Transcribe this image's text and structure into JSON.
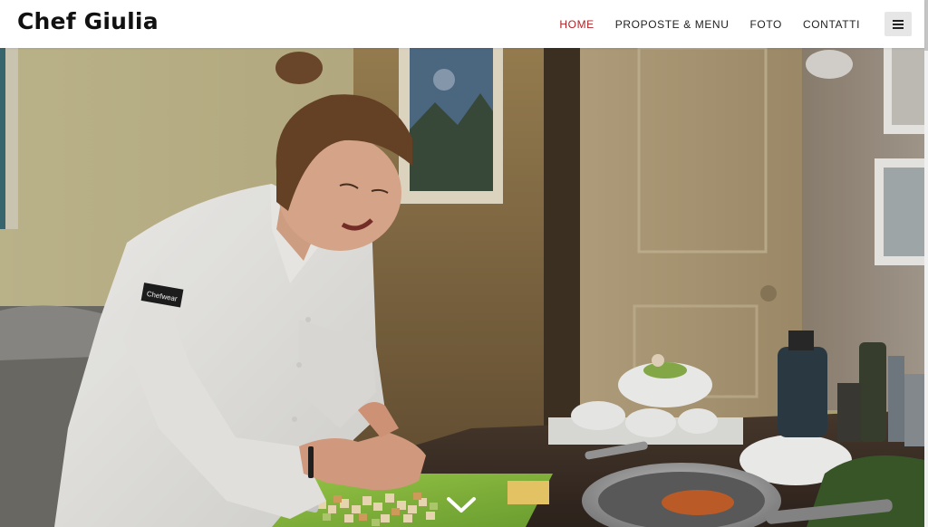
{
  "brand": {
    "name": "Chef Giulia"
  },
  "nav": {
    "items": [
      {
        "label": "HOME",
        "active": true
      },
      {
        "label": "PROPOSTE & MENU",
        "active": false
      },
      {
        "label": "FOTO",
        "active": false
      },
      {
        "label": "CONTATTI",
        "active": false
      }
    ],
    "menu_icon": "hamburger-icon"
  },
  "hero": {
    "patch_text": "Chefwear",
    "scroll_icon": "chevron-down-icon"
  },
  "colors": {
    "active_nav": "#b02125",
    "nav_text": "#222222",
    "toggle_bg": "#e6e6e6"
  }
}
